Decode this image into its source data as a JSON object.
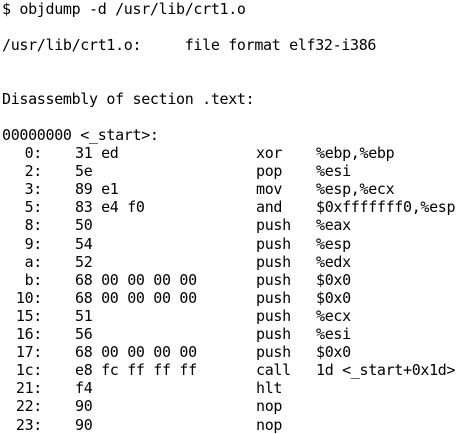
{
  "terminal": {
    "command": "$ objdump -d /usr/lib/crt1.o",
    "file_line": "/usr/lib/crt1.o:     file format elf32-i386",
    "section_header": "Disassembly of section .text:",
    "symbol_header": "00000000 <_start>:",
    "instructions": [
      {
        "addr": "0:",
        "bytes": "31 ed",
        "mnemonic": "xor",
        "operands": "%ebp,%ebp"
      },
      {
        "addr": "2:",
        "bytes": "5e",
        "mnemonic": "pop",
        "operands": "%esi"
      },
      {
        "addr": "3:",
        "bytes": "89 e1",
        "mnemonic": "mov",
        "operands": "%esp,%ecx"
      },
      {
        "addr": "5:",
        "bytes": "83 e4 f0",
        "mnemonic": "and",
        "operands": "$0xfffffff0,%esp"
      },
      {
        "addr": "8:",
        "bytes": "50",
        "mnemonic": "push",
        "operands": "%eax"
      },
      {
        "addr": "9:",
        "bytes": "54",
        "mnemonic": "push",
        "operands": "%esp"
      },
      {
        "addr": "a:",
        "bytes": "52",
        "mnemonic": "push",
        "operands": "%edx"
      },
      {
        "addr": "b:",
        "bytes": "68 00 00 00 00",
        "mnemonic": "push",
        "operands": "$0x0"
      },
      {
        "addr": "10:",
        "bytes": "68 00 00 00 00",
        "mnemonic": "push",
        "operands": "$0x0"
      },
      {
        "addr": "15:",
        "bytes": "51",
        "mnemonic": "push",
        "operands": "%ecx"
      },
      {
        "addr": "16:",
        "bytes": "56",
        "mnemonic": "push",
        "operands": "%esi"
      },
      {
        "addr": "17:",
        "bytes": "68 00 00 00 00",
        "mnemonic": "push",
        "operands": "$0x0"
      },
      {
        "addr": "1c:",
        "bytes": "e8 fc ff ff ff",
        "mnemonic": "call",
        "operands": "1d <_start+0x1d>"
      },
      {
        "addr": "21:",
        "bytes": "f4",
        "mnemonic": "hlt",
        "operands": ""
      },
      {
        "addr": "22:",
        "bytes": "90",
        "mnemonic": "nop",
        "operands": ""
      },
      {
        "addr": "23:",
        "bytes": "90",
        "mnemonic": "nop",
        "operands": ""
      }
    ]
  }
}
